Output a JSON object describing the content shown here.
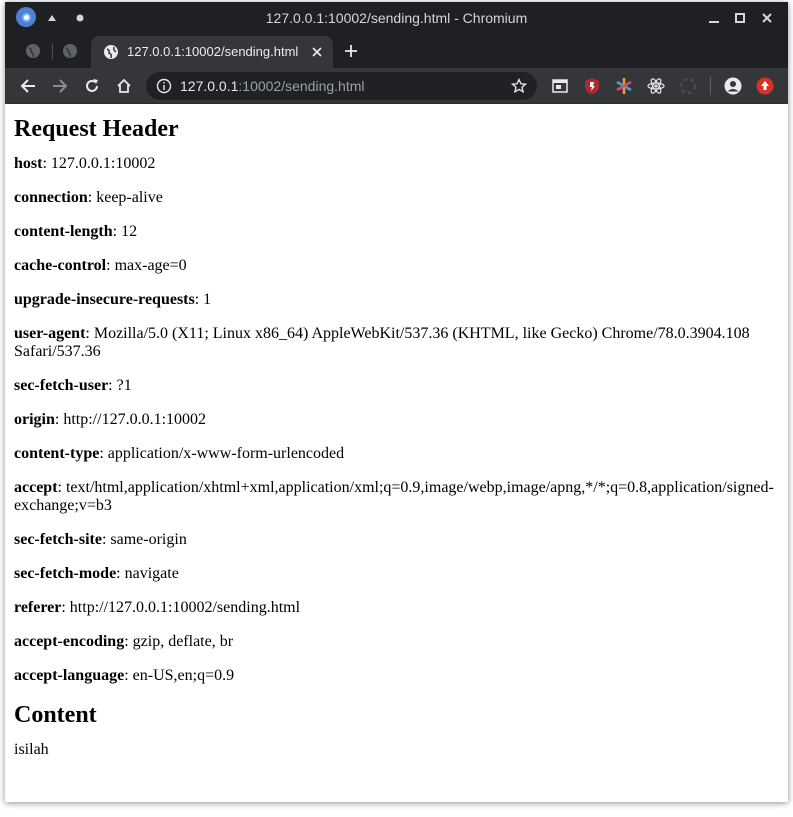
{
  "window": {
    "title": "127.0.0.1:10002/sending.html - Chromium"
  },
  "tabs": {
    "active_title": "127.0.0.1:10002/sending.html"
  },
  "omnibox": {
    "host": "127.0.0.1",
    "path": ":10002/sending.html"
  },
  "page": {
    "heading_request": "Request Header",
    "headers": [
      {
        "key": "host",
        "value": ": 127.0.0.1:10002"
      },
      {
        "key": "connection",
        "value": ": keep-alive"
      },
      {
        "key": "content-length",
        "value": ": 12"
      },
      {
        "key": "cache-control",
        "value": ": max-age=0"
      },
      {
        "key": "upgrade-insecure-requests",
        "value": ": 1"
      },
      {
        "key": "user-agent",
        "value": ": Mozilla/5.0 (X11; Linux x86_64) AppleWebKit/537.36 (KHTML, like Gecko) Chrome/78.0.3904.108 Safari/537.36"
      },
      {
        "key": "sec-fetch-user",
        "value": ": ?1"
      },
      {
        "key": "origin",
        "value": ": http://127.0.0.1:10002"
      },
      {
        "key": "content-type",
        "value": ": application/x-www-form-urlencoded"
      },
      {
        "key": "accept",
        "value": ": text/html,application/xhtml+xml,application/xml;q=0.9,image/webp,image/apng,*/*;q=0.8,application/signed-exchange;v=b3"
      },
      {
        "key": "sec-fetch-site",
        "value": ": same-origin"
      },
      {
        "key": "sec-fetch-mode",
        "value": ": navigate"
      },
      {
        "key": "referer",
        "value": ": http://127.0.0.1:10002/sending.html"
      },
      {
        "key": "accept-encoding",
        "value": ": gzip, deflate, br"
      },
      {
        "key": "accept-language",
        "value": ": en-US,en;q=0.9"
      }
    ],
    "heading_content": "Content",
    "content_text": "isilah"
  }
}
